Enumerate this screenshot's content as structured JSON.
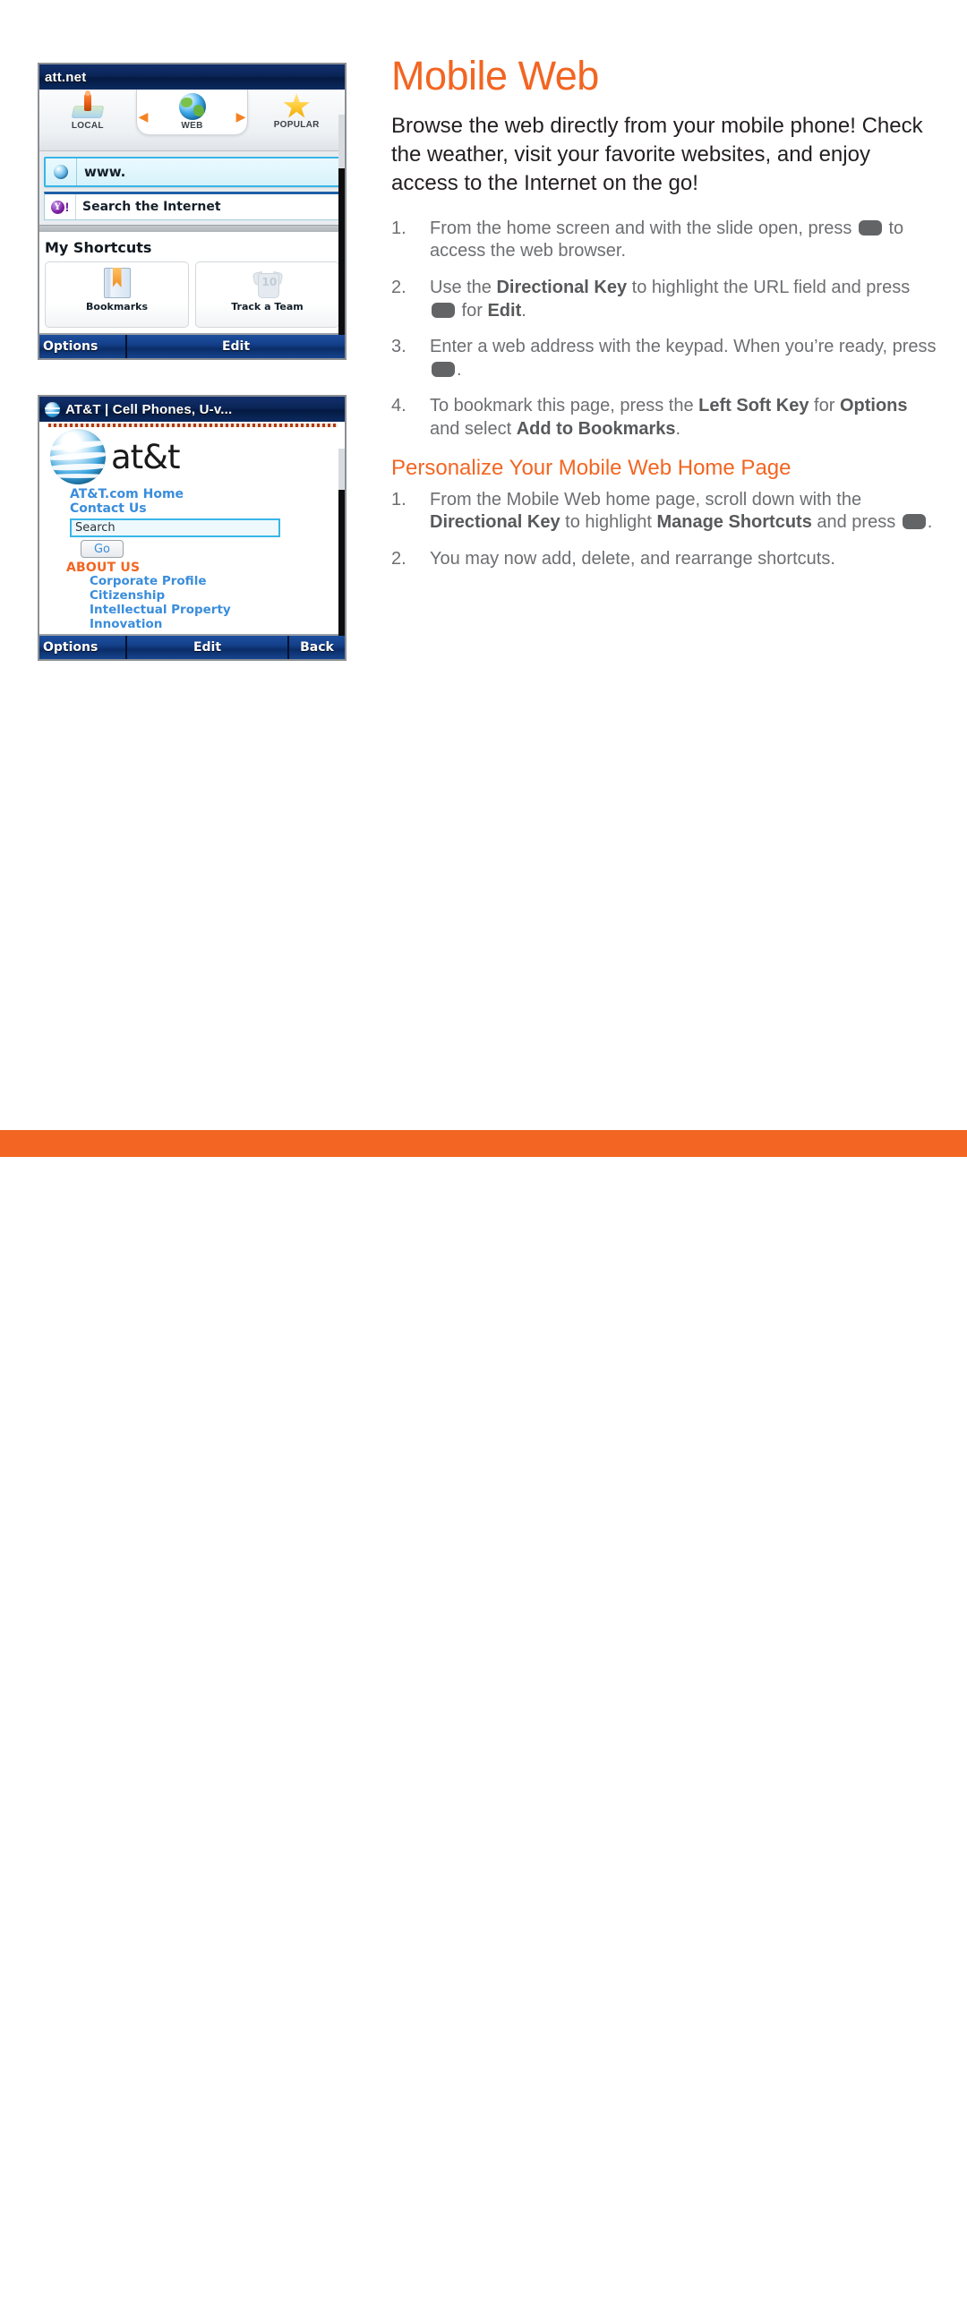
{
  "article": {
    "title": "Mobile Web",
    "intro": "Browse the web directly from your mobile phone! Check the weather, visit your favorite websites, and enjoy access to the Internet on the go!",
    "subhead": "Personalize Your Mobile Web Home Page",
    "steps_primary": [
      {
        "n": "1.",
        "segments": [
          {
            "t": "From the home screen and with the slide open, press ",
            "style": "normal"
          },
          {
            "t": "",
            "style": "key"
          },
          {
            "t": " to access the web browser.",
            "style": "normal"
          }
        ]
      },
      {
        "n": "2.",
        "segments": [
          {
            "t": "Use the ",
            "style": "normal"
          },
          {
            "t": "Directional Key",
            "style": "bold"
          },
          {
            "t": " to highlight the URL field and press ",
            "style": "normal"
          },
          {
            "t": "",
            "style": "key"
          },
          {
            "t": " for ",
            "style": "normal"
          },
          {
            "t": "Edit",
            "style": "bold"
          },
          {
            "t": ".",
            "style": "normal"
          }
        ]
      },
      {
        "n": "3.",
        "segments": [
          {
            "t": "Enter a web address with the keypad. When you’re ready, press ",
            "style": "normal"
          },
          {
            "t": "",
            "style": "key"
          },
          {
            "t": ".",
            "style": "normal"
          }
        ]
      },
      {
        "n": "4.",
        "segments": [
          {
            "t": "To bookmark this page, press the ",
            "style": "normal"
          },
          {
            "t": "Left Soft Key",
            "style": "bold"
          },
          {
            "t": " for ",
            "style": "normal"
          },
          {
            "t": "Options",
            "style": "bold"
          },
          {
            "t": " and select ",
            "style": "normal"
          },
          {
            "t": "Add to Bookmarks",
            "style": "bold"
          },
          {
            "t": ".",
            "style": "normal"
          }
        ]
      }
    ],
    "steps_secondary": [
      {
        "n": "1.",
        "segments": [
          {
            "t": "From the Mobile Web home page, scroll down with the ",
            "style": "normal"
          },
          {
            "t": "Directional Key",
            "style": "bold"
          },
          {
            "t": " to highlight ",
            "style": "normal"
          },
          {
            "t": "Manage Shortcuts",
            "style": "bold"
          },
          {
            "t": " and press ",
            "style": "normal"
          },
          {
            "t": "",
            "style": "key"
          },
          {
            "t": ".",
            "style": "normal"
          }
        ]
      },
      {
        "n": "2.",
        "segments": [
          {
            "t": "You may now add, delete, and rearrange shortcuts.",
            "style": "normal"
          }
        ]
      }
    ]
  },
  "screen_home": {
    "titlebar": "att.net",
    "carousel": [
      {
        "label": "LOCAL",
        "icon": "map-pin-icon"
      },
      {
        "label": "WEB",
        "icon": "globe-icon"
      },
      {
        "label": "POPULAR",
        "icon": "star-icon"
      }
    ],
    "url_field": {
      "value": "www.",
      "icon": "globe-icon"
    },
    "search_row": {
      "label": "Search the Internet",
      "icon": "yahoo-icon"
    },
    "shortcuts_title": "My Shortcuts",
    "shortcuts": [
      {
        "label": "Bookmarks",
        "icon": "bookmark-icon"
      },
      {
        "label": "Track a Team",
        "icon": "jersey-icon"
      }
    ],
    "softkeys": {
      "left": "Options",
      "center": "Edit",
      "right": ""
    }
  },
  "screen_site": {
    "titlebar": "AT&T | Cell Phones, U-v...",
    "logo_word": "at&t",
    "links_top": [
      "AT&T.com Home",
      "Contact Us"
    ],
    "search_value": "Search",
    "go_label": "Go",
    "section_heading": "ABOUT US",
    "section_links": [
      "Corporate Profile",
      "Citizenship",
      "Intellectual Property",
      "Innovation"
    ],
    "softkeys": {
      "left": "Options",
      "center": "Edit",
      "right": "Back"
    }
  },
  "colors": {
    "accent_orange": "#f26522",
    "body_gray": "#6d6e71",
    "bold_gray": "#58595b",
    "link_blue": "#3a8ddb",
    "titlebar_blue": "#0a2456"
  }
}
